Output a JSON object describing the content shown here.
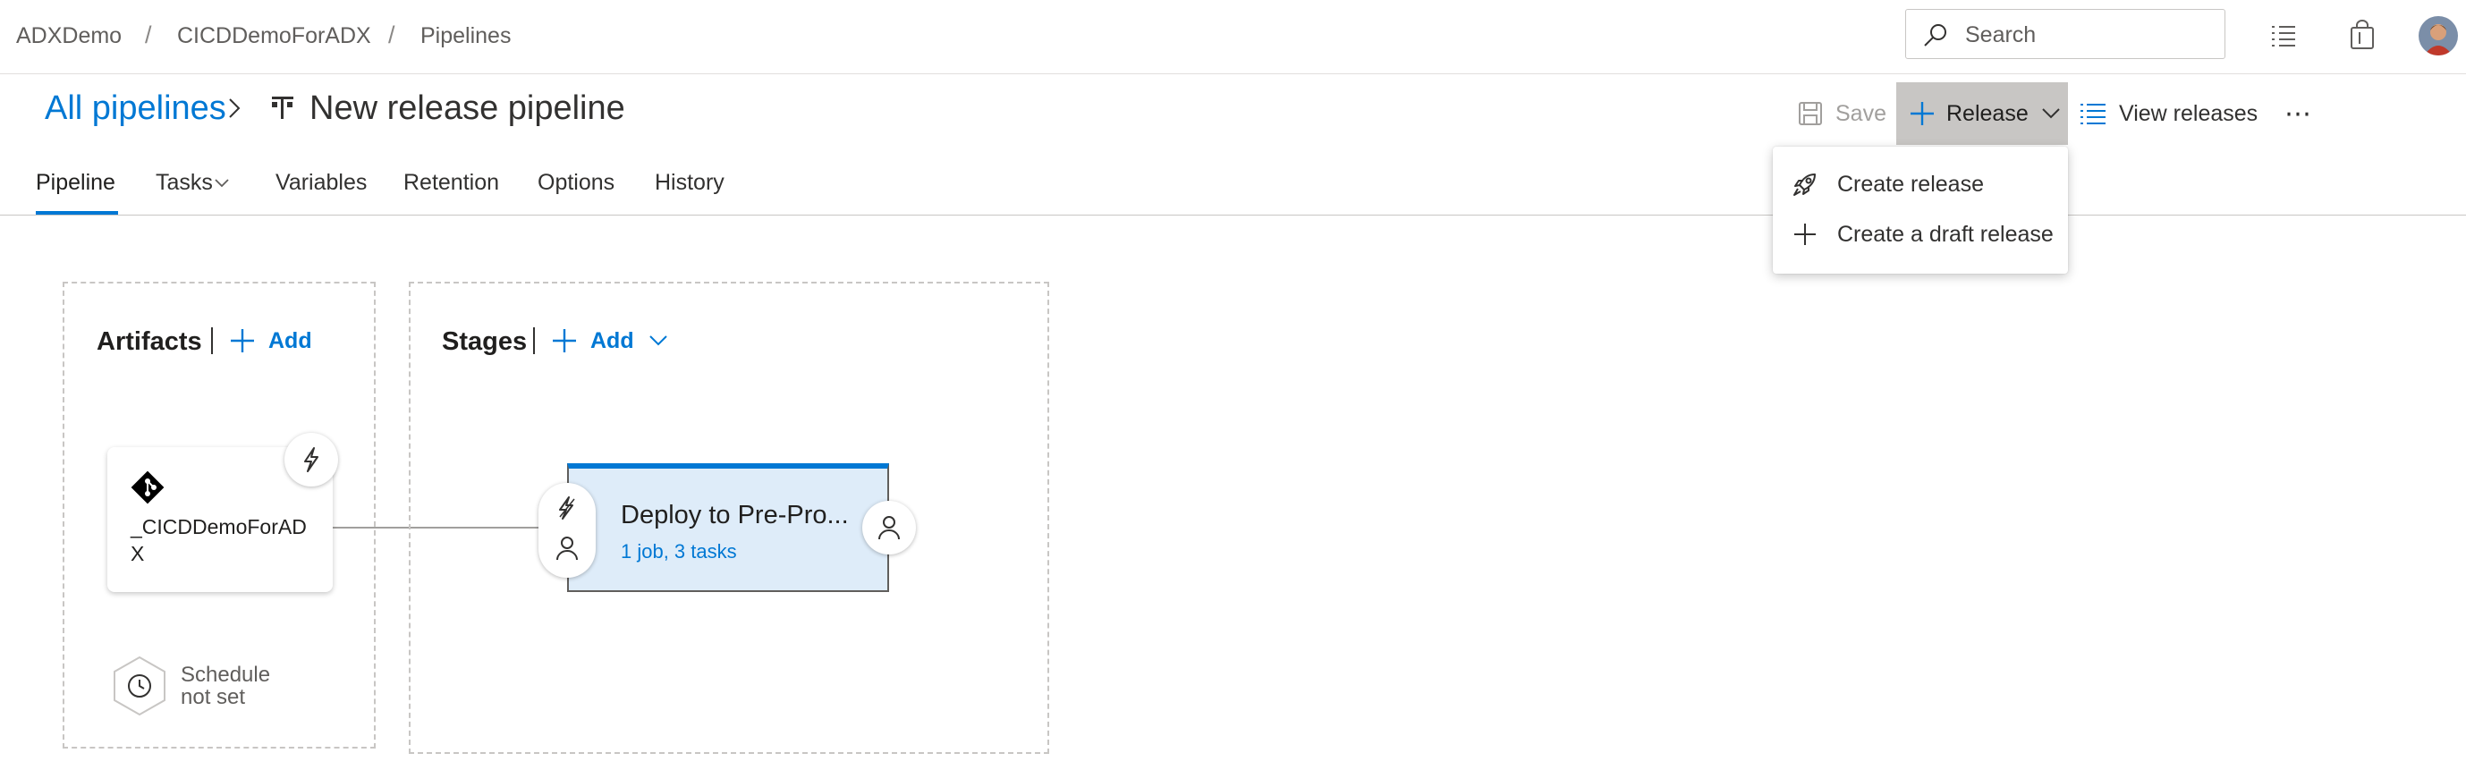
{
  "breadcrumb": {
    "items": [
      "ADXDemo",
      "CICDDemoForADX",
      "Pipelines"
    ],
    "separator": "/"
  },
  "search": {
    "placeholder": "Search"
  },
  "header_icons": [
    "list-check-icon",
    "shopping-bag-icon",
    "user-avatar"
  ],
  "title": {
    "back_link": "All pipelines",
    "pipeline_name": "New release pipeline",
    "pipeline_icon": "release-pipeline-icon"
  },
  "toolbar": {
    "save_label": "Save",
    "release_label": "Release",
    "view_releases_label": "View releases",
    "more_label": "⋯"
  },
  "release_menu": {
    "items": [
      {
        "label": "Create release",
        "icon": "rocket-icon"
      },
      {
        "label": "Create a draft release",
        "icon": "plus-icon"
      }
    ]
  },
  "tabs": [
    {
      "label": "Pipeline",
      "selected": true
    },
    {
      "label": "Tasks",
      "has_dropdown": true
    },
    {
      "label": "Variables"
    },
    {
      "label": "Retention"
    },
    {
      "label": "Options"
    },
    {
      "label": "History"
    }
  ],
  "artifacts": {
    "heading": "Artifacts",
    "add_label": "Add",
    "artifact": {
      "name_line1": "_CICDDemoForAD",
      "name_line2": "X",
      "icon": "git-icon"
    },
    "schedule": {
      "line1": "Schedule",
      "line2": "not set"
    }
  },
  "stages": {
    "heading": "Stages",
    "add_label": "Add",
    "stage": {
      "name": "Deploy to Pre-Pro...",
      "summary": "1 job, 3 tasks"
    }
  },
  "colors": {
    "accent": "#0078d4",
    "stage_bg": "#deecf9",
    "release_button_bg": "#c8c6c4",
    "text": "#323130",
    "muted": "#605e5c"
  }
}
